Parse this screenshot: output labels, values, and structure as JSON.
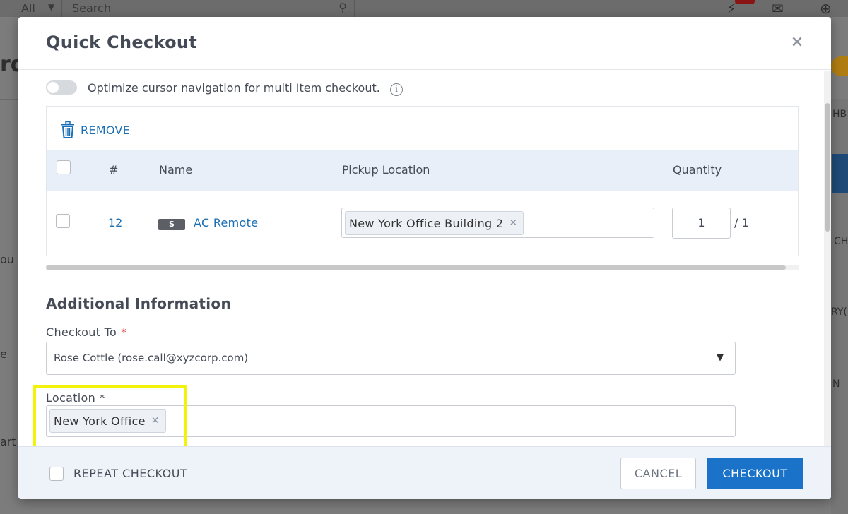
{
  "background": {
    "filter_label": "All",
    "search_placeholder": "Search",
    "fragments": [
      "rd",
      "ou",
      "e",
      "art",
      "HB",
      "CH",
      "RY(",
      "N"
    ]
  },
  "modal": {
    "title": "Quick Checkout",
    "close_label": "×",
    "toggle_label": "Optimize cursor navigation for multi Item checkout.",
    "toggle_on": false,
    "info_icon": "i"
  },
  "items": {
    "remove_label": "REMOVE",
    "columns": [
      "#",
      "Name",
      "Pickup Location",
      "Quantity"
    ],
    "rows": [
      {
        "number": "12",
        "type_badge": "S",
        "name": "AC Remote",
        "pickup_location": "New York Office Building 2",
        "quantity": "1",
        "quantity_total": "/ 1"
      }
    ]
  },
  "additional": {
    "title": "Additional Information",
    "checkout_to_label": "Checkout To",
    "checkout_to_value": "Rose Cottle (rose.call@xyzcorp.com)",
    "location_label": "Location *",
    "location_value": "New York Office"
  },
  "footer": {
    "repeat_label": "REPEAT CHECKOUT",
    "cancel_label": "CANCEL",
    "checkout_label": "CHECKOUT"
  },
  "colors": {
    "primary": "#1a73c9",
    "link": "#1a6fb5",
    "highlight": "#f2f20a",
    "required": "#e03e3e"
  }
}
